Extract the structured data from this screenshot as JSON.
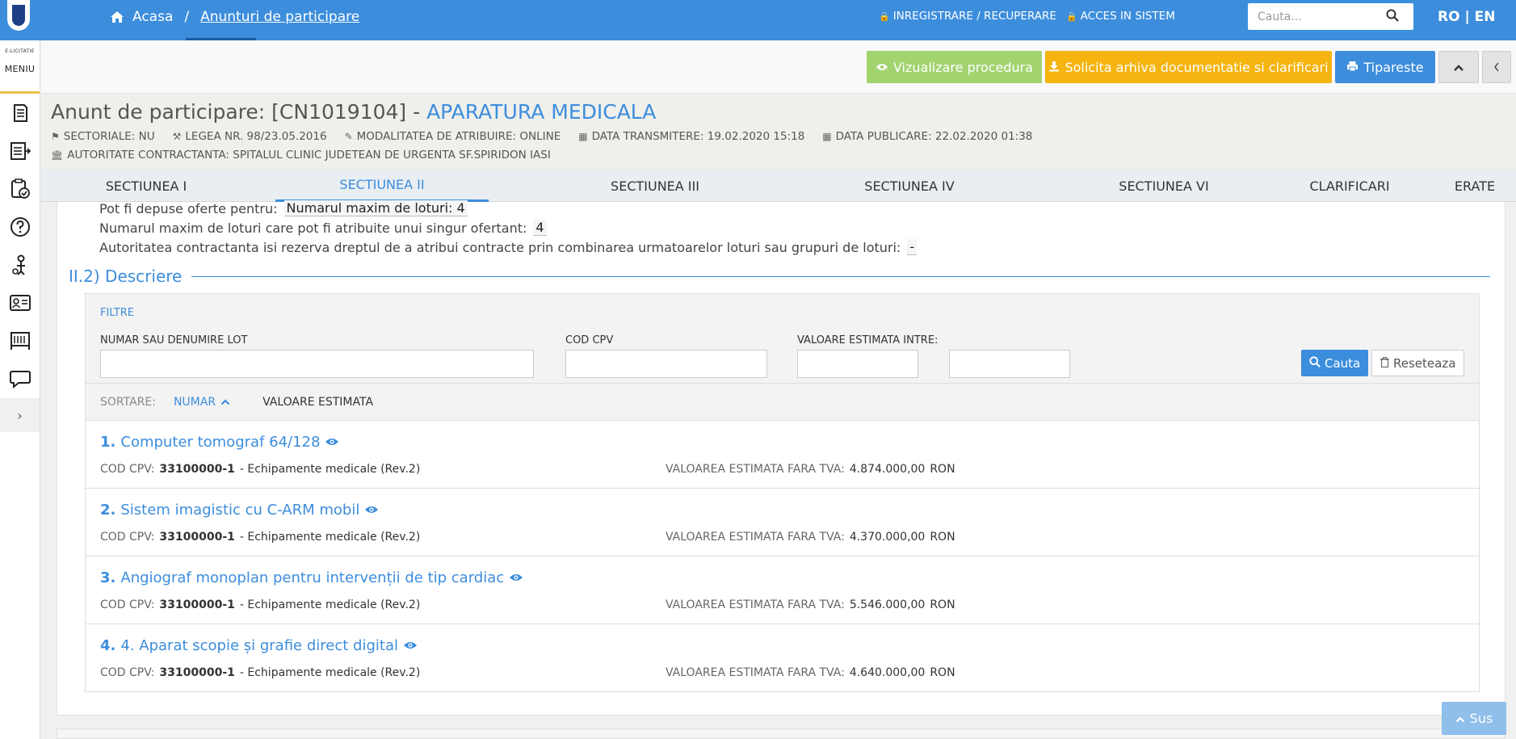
{
  "topbar": {
    "home_label": "Acasa",
    "separator": "/",
    "current": "Anunturi de participare",
    "register": "INREGISTRARE / RECUPERARE",
    "login": "ACCES IN SISTEM",
    "search_placeholder": "Cauta...",
    "lang": "RO | EN"
  },
  "sidebar": {
    "brand_small": "E-LICITATIE",
    "menu_label": "MENIU",
    "items": [
      "document-icon",
      "list-export-icon",
      "clipboard-check-icon",
      "help-icon",
      "person-icon",
      "id-card-icon",
      "board-icon",
      "chat-icon"
    ],
    "expand": "›"
  },
  "toolbar": {
    "view_procedure": "Vizualizare procedura",
    "request_archive": "Solicita arhiva documentatie si clarificari",
    "print": "Tipareste"
  },
  "header": {
    "title_prefix": "Anunt de participare: [CN1019104] - ",
    "title_accent": "APARATURA MEDICALA",
    "sectoriale": "SECTORIALE: NU",
    "legea": "LEGEA NR. 98/23.05.2016",
    "modalitatea": "MODALITATEA DE ATRIBUIRE: ONLINE",
    "data_transmitere": "DATA TRANSMITERE: 19.02.2020 15:18",
    "data_publicare": "DATA PUBLICARE: 22.02.2020 01:38",
    "autoritate": "AUTORITATE CONTRACTANTA: SPITALUL CLINIC JUDETEAN DE URGENTA SF.SPIRIDON IASI"
  },
  "tabs": [
    "SECTIUNEA I",
    "SECTIUNEA II",
    "SECTIUNEA III",
    "SECTIUNEA IV",
    "SECTIUNEA VI",
    "CLARIFICARI",
    "ERATE"
  ],
  "lots_info": {
    "oferte_label": "Pot fi depuse oferte pentru:",
    "oferte_value": "Numarul maxim de loturi: 4",
    "max_label": "Numarul maxim de loturi care pot fi atribuite unui singur ofertant:",
    "max_value": "4",
    "rezerva_label": "Autoritatea contractanta isi rezerva dreptul de a atribui contracte prin combinarea urmatoarelor loturi sau grupuri de loturi:",
    "rezerva_value": "-"
  },
  "section_title": "II.2) Descriere",
  "filters": {
    "title": "FILTRE",
    "lot_label": "NUMAR SAU DENUMIRE LOT",
    "cpv_label": "COD CPV",
    "valoare_label": "VALOARE ESTIMATA INTRE:",
    "dash": "-",
    "search_button": "Cauta",
    "reset_button": "Reseteaza"
  },
  "sort": {
    "label": "SORTARE:",
    "active": "NUMAR",
    "other": "VALOARE ESTIMATA"
  },
  "lots": [
    {
      "num": "1.",
      "title": "Computer tomograf 64/128",
      "cpv_key": "COD CPV:",
      "cpv_code": "33100000-1",
      "cpv_desc": "- Echipamente medicale (Rev.2)",
      "val_key": "VALOAREA ESTIMATA FARA TVA:",
      "value": "4.874.000,00",
      "currency": "RON"
    },
    {
      "num": "2.",
      "title": "Sistem imagistic cu C-ARM mobil",
      "cpv_key": "COD CPV:",
      "cpv_code": "33100000-1",
      "cpv_desc": "- Echipamente medicale (Rev.2)",
      "val_key": "VALOAREA ESTIMATA FARA TVA:",
      "value": "4.370.000,00",
      "currency": "RON"
    },
    {
      "num": "3.",
      "title": "Angiograf monoplan pentru intervenții de tip cardiac",
      "cpv_key": "COD CPV:",
      "cpv_code": "33100000-1",
      "cpv_desc": "- Echipamente medicale (Rev.2)",
      "val_key": "VALOAREA ESTIMATA FARA TVA:",
      "value": "5.546.000,00",
      "currency": "RON"
    },
    {
      "num": "4.",
      "title": "4. Aparat scopie și grafie direct digital",
      "cpv_key": "COD CPV:",
      "cpv_code": "33100000-1",
      "cpv_desc": "- Echipamente medicale (Rev.2)",
      "val_key": "VALOAREA ESTIMATA FARA TVA:",
      "value": "4.640.000,00",
      "currency": "RON"
    }
  ],
  "back_to_top": "Sus"
}
